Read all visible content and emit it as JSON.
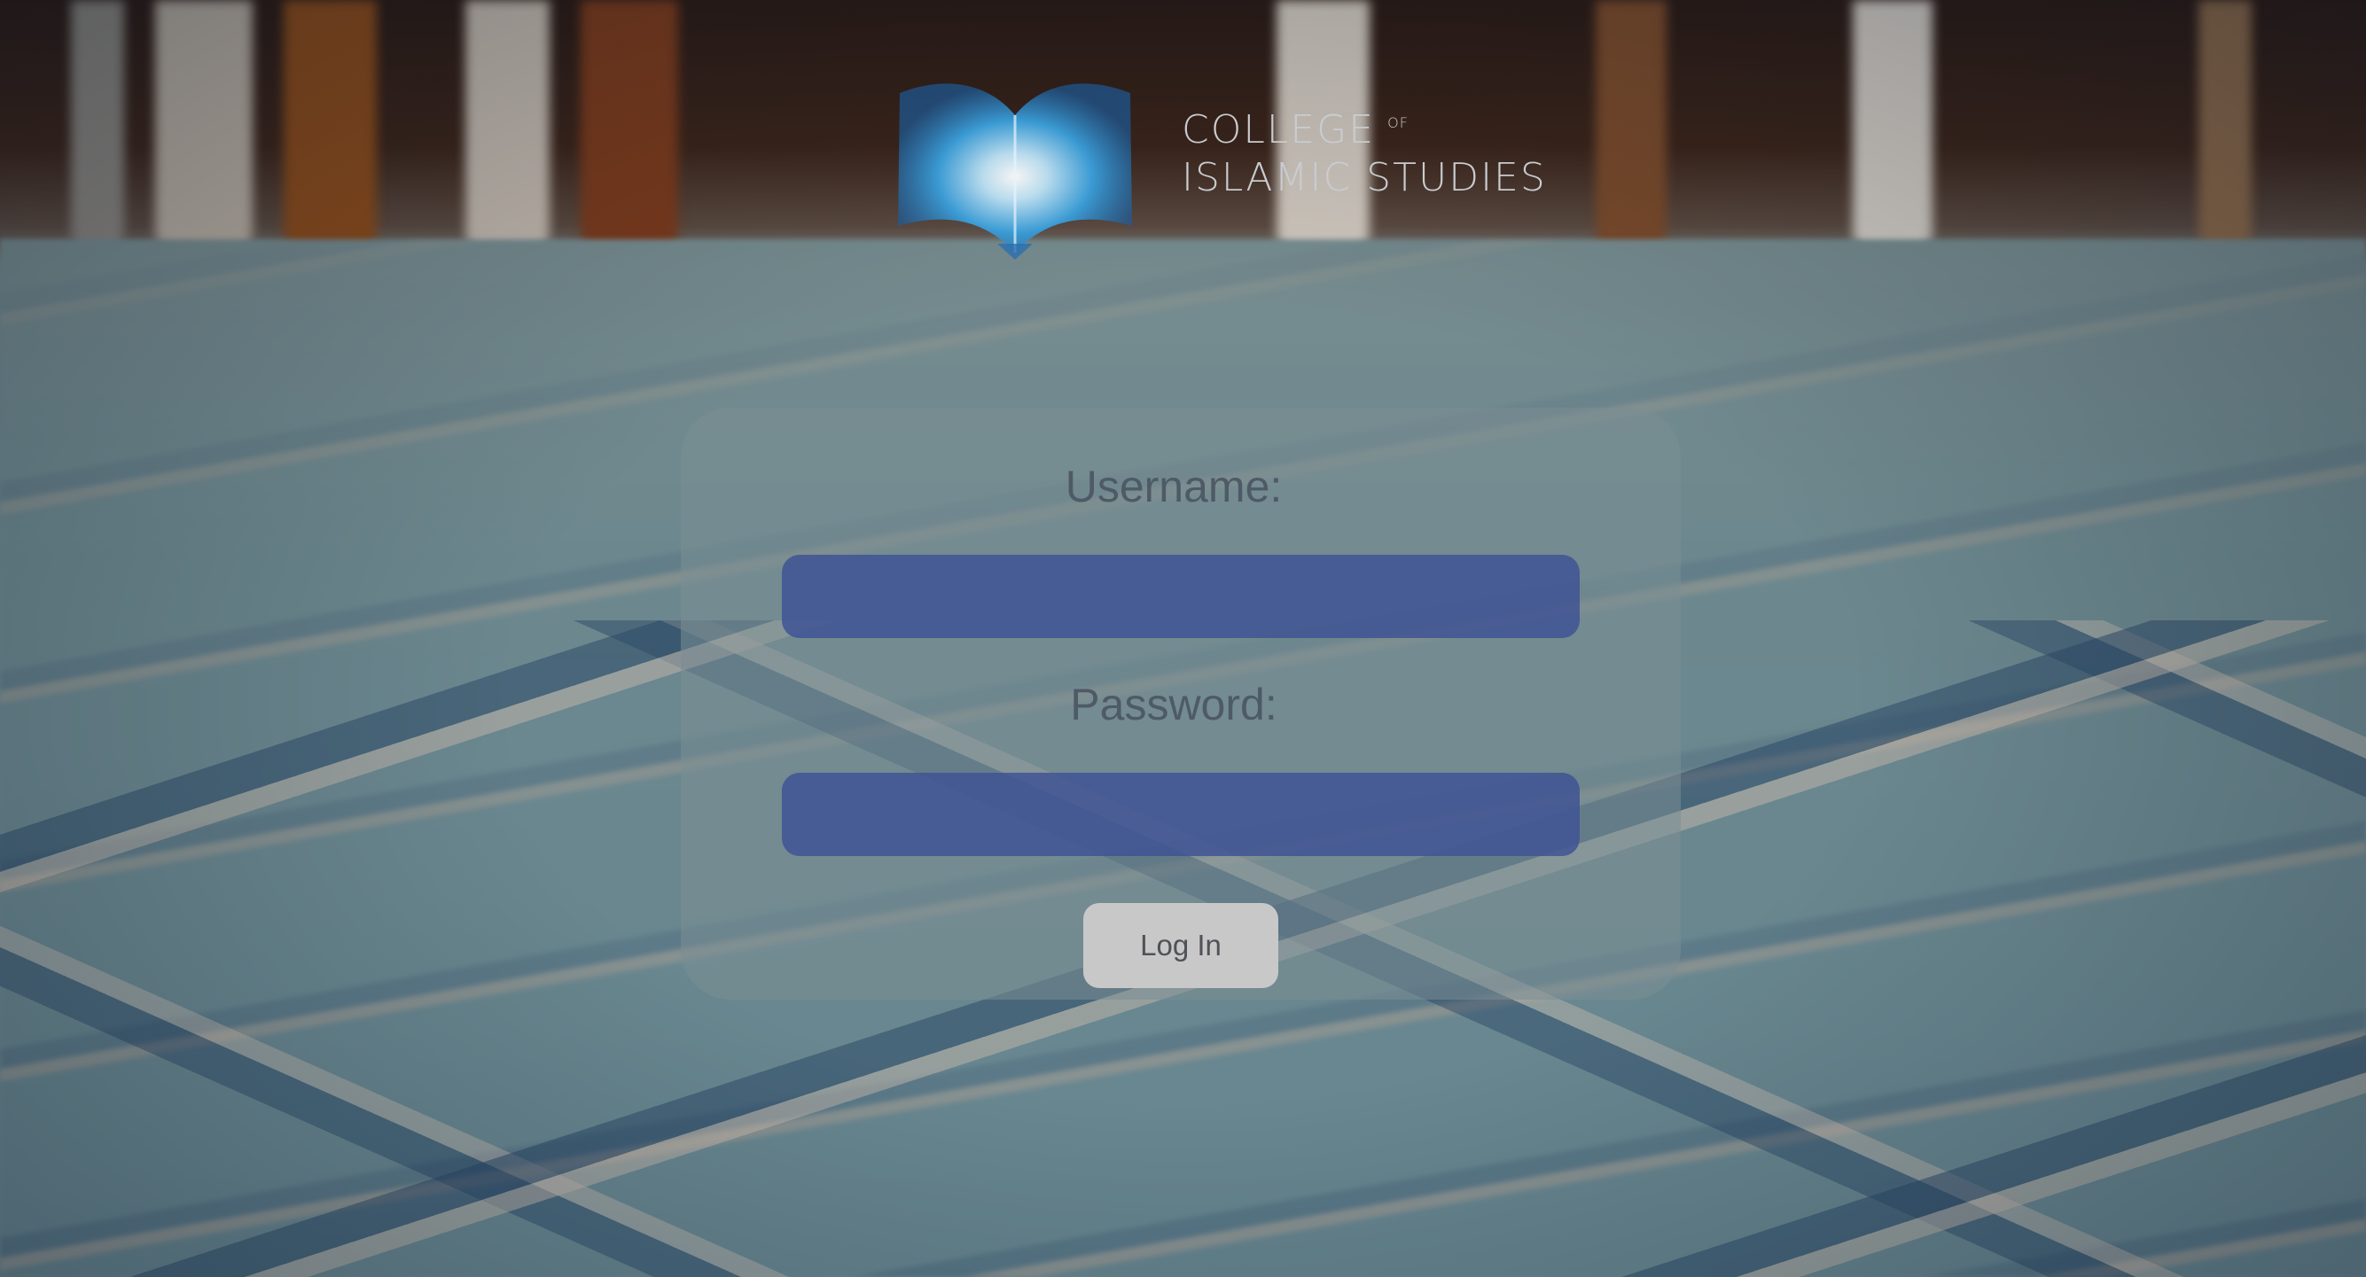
{
  "logo": {
    "line1": "COLLEGE",
    "of": "OF",
    "line2": "ISLAMIC STUDIES"
  },
  "login_form": {
    "username_label": "Username:",
    "username_value": "",
    "password_label": "Password:",
    "password_value": "",
    "submit_label": "Log In"
  },
  "colors": {
    "field_bg": "#3f5494",
    "button_bg": "#c8c8c8",
    "label_text": "#4e5a66",
    "logo_text": "#c9ccd0",
    "logo_mark": "#3aa0dc"
  }
}
